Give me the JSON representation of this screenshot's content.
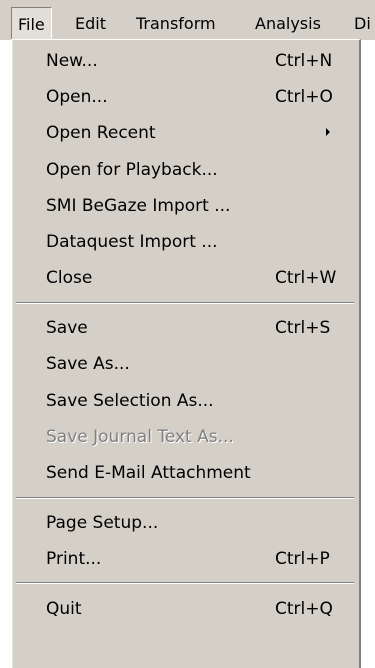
{
  "menubar": {
    "file": "File",
    "edit": "Edit",
    "transform": "Transform",
    "analysis": "Analysis",
    "next_cut": "Di"
  },
  "file_menu": {
    "new": {
      "label": "New...",
      "shortcut": "Ctrl+N"
    },
    "open": {
      "label": "Open...",
      "shortcut": "Ctrl+O"
    },
    "open_recent": {
      "label": "Open Recent"
    },
    "open_playback": {
      "label": "Open for Playback..."
    },
    "smi_import": {
      "label": "SMI BeGaze Import ..."
    },
    "dataquest_import": {
      "label": "Dataquest Import ..."
    },
    "close": {
      "label": "Close",
      "shortcut": "Ctrl+W"
    },
    "save": {
      "label": "Save",
      "shortcut": "Ctrl+S"
    },
    "save_as": {
      "label": "Save As..."
    },
    "save_selection_as": {
      "label": "Save Selection As..."
    },
    "save_journal_text_as": {
      "label": "Save Journal Text As...",
      "disabled": true
    },
    "send_email": {
      "label": "Send E-Mail Attachment"
    },
    "page_setup": {
      "label": "Page Setup..."
    },
    "print": {
      "label": "Print...",
      "shortcut": "Ctrl+P"
    },
    "quit": {
      "label": "Quit",
      "shortcut": "Ctrl+Q"
    }
  },
  "colors": {
    "menu_bg": "#d4d0c8",
    "disabled_text": "#808080"
  },
  "icons": {
    "submenu": "submenu-arrow-icon"
  }
}
